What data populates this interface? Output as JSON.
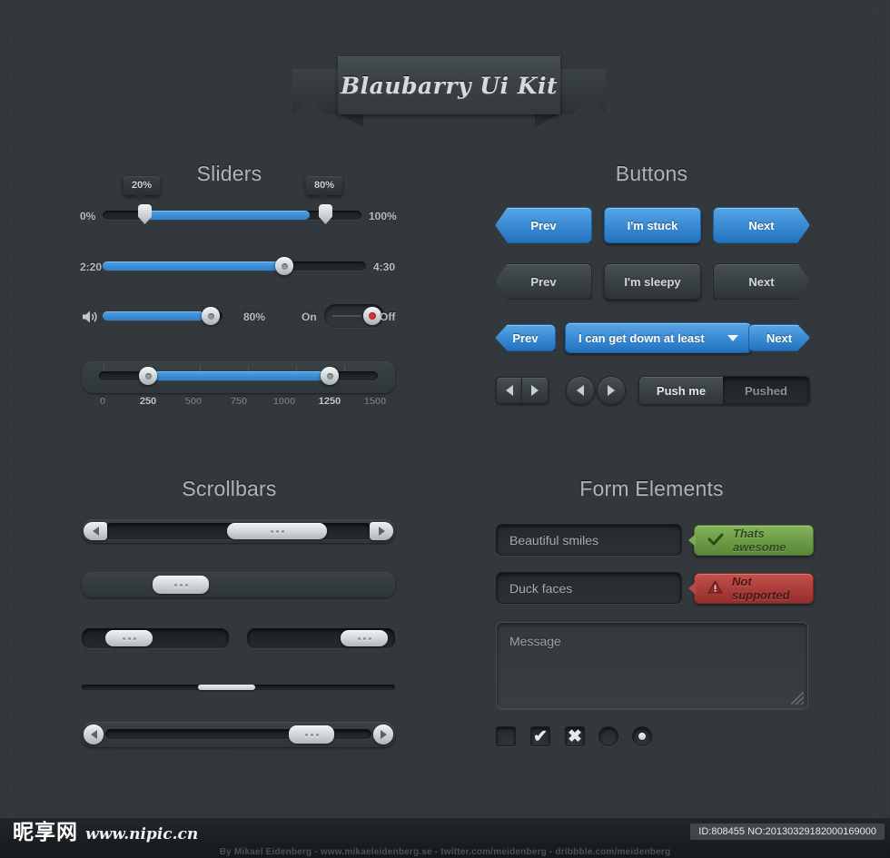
{
  "header": {
    "ribbon_title": "Blaubarry Ui Kit"
  },
  "sections": {
    "sliders_title": "Sliders",
    "buttons_title": "Buttons",
    "scrollbars_title": "Scrollbars",
    "form_title": "Form Elements"
  },
  "sliders": {
    "range": {
      "min_label": "0%",
      "max_label": "100%",
      "low_tooltip": "20%",
      "high_tooltip": "80%",
      "low_value": 20,
      "high_value": 80
    },
    "time": {
      "min_label": "2:20",
      "max_label": "4:30",
      "value": 68
    },
    "volume": {
      "icon": "speaker-icon",
      "value_label": "80%",
      "value": 80
    },
    "toggle": {
      "on_label": "On",
      "off_label": "Off",
      "state": "off"
    },
    "scale": {
      "ticks": [
        "0",
        "250",
        "500",
        "750",
        "1000",
        "1250",
        "1500"
      ],
      "active_ticks": [
        "250",
        "1250"
      ],
      "low_value": 250,
      "high_value": 1250,
      "min": 0,
      "max": 1500
    }
  },
  "buttons": {
    "row1": [
      {
        "label": "Prev",
        "style": "blue",
        "shape": "arrow-left"
      },
      {
        "label": "I'm stuck",
        "style": "blue",
        "shape": "rect"
      },
      {
        "label": "Next",
        "style": "blue",
        "shape": "arrow-right"
      }
    ],
    "row2": [
      {
        "label": "Prev",
        "style": "dark",
        "shape": "arrow-left"
      },
      {
        "label": "I'm sleepy",
        "style": "dark",
        "shape": "rect"
      },
      {
        "label": "Next",
        "style": "dark",
        "shape": "arrow-right"
      }
    ],
    "row3": {
      "prev": "Prev",
      "dropdown": "I can get down at least",
      "next": "Next"
    },
    "row4": {
      "segmented": {
        "raised": "Push me",
        "pressed": "Pushed"
      },
      "arrows": [
        "left-arrow-icon",
        "right-arrow-icon"
      ]
    }
  },
  "scrollbars": {
    "bar1": {
      "left_arrow": "left-arrow-icon",
      "right_arrow": "right-arrow-icon",
      "thumb": "grip-dots"
    },
    "bar2": {
      "thumb": "grip-dots"
    },
    "bar3_left": {
      "thumb": "grip-dots"
    },
    "bar3_right": {
      "thumb": "grip-dots"
    },
    "bar4": {
      "thumb": "plain"
    },
    "bar5": {
      "left_arrow": "left-arrow-icon",
      "right_arrow": "right-arrow-icon",
      "thumb": "grip-dots"
    }
  },
  "form": {
    "input1": {
      "value": "Beautiful smiles"
    },
    "input2": {
      "value": "Duck faces"
    },
    "badge_success": {
      "label": "Thats awesome",
      "icon": "check-icon",
      "color": "#6d9c46"
    },
    "badge_error": {
      "label": "Not supported",
      "icon": "warning-icon",
      "color": "#ab3e3b"
    },
    "textarea": {
      "value": "Message"
    },
    "checkboxes": [
      {
        "name": "checkbox-empty",
        "mark": ""
      },
      {
        "name": "checkbox-checked",
        "mark": "✔"
      },
      {
        "name": "checkbox-crossed",
        "mark": "✖"
      }
    ],
    "radios": [
      {
        "name": "radio-empty",
        "selected": false
      },
      {
        "name": "radio-selected",
        "selected": true
      }
    ]
  },
  "footer": {
    "watermark_cjk": "昵享网",
    "watermark_url": "www.nipic.cn",
    "id_badge": "ID:808455 NO:20130329182000169000",
    "credit": "By Mikael Eidenberg - www.mikaeleidenberg.se - twitter.com/meidenberg - dribbble.com/meidenberg"
  }
}
